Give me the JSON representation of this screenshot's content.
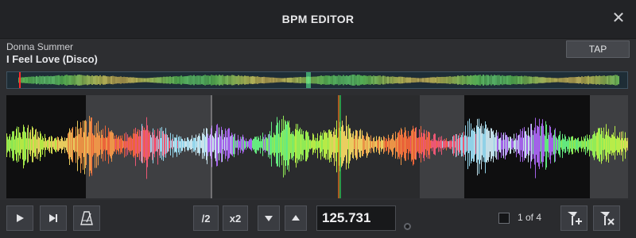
{
  "window": {
    "title": "BPM EDITOR",
    "close_glyph": "✕"
  },
  "track": {
    "artist": "Donna Summer",
    "title": "I Feel Love (Disco)"
  },
  "buttons": {
    "tap": "TAP",
    "half": "/2",
    "double": "x2"
  },
  "bpm": {
    "value": "125.731"
  },
  "beatgrid": {
    "page_label": "1 of 4"
  },
  "icons": {
    "play": "play-icon",
    "next": "skip-next-icon",
    "metronome": "metronome-icon",
    "down": "arrow-down-icon",
    "up": "arrow-up-icon",
    "add_marker": "add-marker-icon",
    "remove_marker": "remove-marker-icon"
  },
  "colors": {
    "background": "#2d2e31",
    "titlebar": "#222326",
    "waveform_bg": "#3e3f42",
    "playhead": "#ff2a2a",
    "beat_marker_orange": "#ff7a1a",
    "beat_marker_green": "#2ee05a"
  }
}
